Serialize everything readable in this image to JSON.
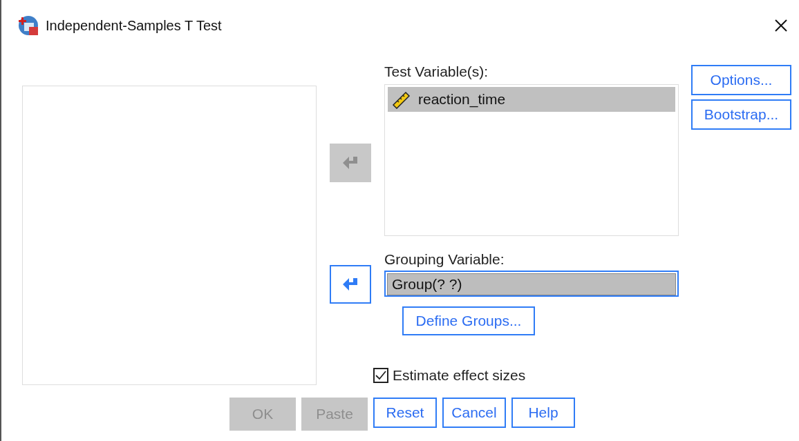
{
  "window": {
    "title": "Independent-Samples T Test"
  },
  "move_buttons": [
    {
      "disabled": true
    },
    {
      "disabled": false
    }
  ],
  "test_variables": {
    "label": "Test Variable(s):",
    "items": [
      {
        "name": "reaction_time",
        "selected": true
      }
    ]
  },
  "grouping_variable": {
    "label": "Grouping Variable:",
    "value": "Group(? ?)",
    "selected": true
  },
  "define_groups_button": {
    "label": "Define Groups...",
    "disabled": false
  },
  "effect_sizes": {
    "label": "Estimate effect sizes",
    "checked": true
  },
  "side_buttons": [
    {
      "label": "Options...",
      "disabled": false
    },
    {
      "label": "Bootstrap...",
      "disabled": false
    }
  ],
  "footer_buttons": [
    {
      "label": "OK",
      "disabled": true
    },
    {
      "label": "Paste",
      "disabled": true
    },
    {
      "label": "Reset",
      "disabled": false
    },
    {
      "label": "Cancel",
      "disabled": false
    },
    {
      "label": "Help",
      "disabled": false
    }
  ]
}
